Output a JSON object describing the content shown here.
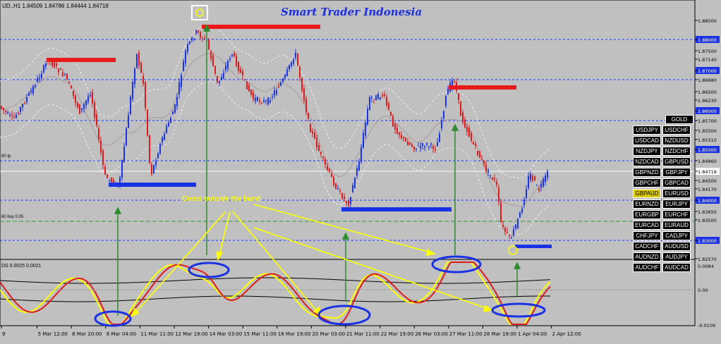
{
  "header": {
    "symbol_line": "UD.,H1  1.84509 1.84786 1.84444 1.84718",
    "title": "Smart Trader Indonesia"
  },
  "levels": {
    "tp_label": "60 tp",
    "buy_label": "60 buy 0.05"
  },
  "indicator": {
    "label": "DS 0.0025 0.0021"
  },
  "annotation": "Cross outside the band",
  "price_scale": [
    "1.88500",
    "1.88000",
    "1.87500",
    "1.87140",
    "1.87000",
    "1.86680",
    "1.86500",
    "1.86230",
    "1.86000",
    "1.85700",
    "1.85500",
    "1.85310",
    "1.85000",
    "1.84860",
    "1.84718",
    "1.84500",
    "1.84170",
    "1.84000",
    "1.83650",
    "1.83500",
    "1.83000",
    "1.82570"
  ],
  "current_price": "1.84718",
  "ind_scale": [
    "0.0084",
    "0.00",
    "-0.0109"
  ],
  "time_axis": [
    "9",
    "5 Mar 12:00",
    "6 Mar 20:00",
    "8 Mar 04:00",
    "11 Mar 11:00",
    "12 Mar 19:00",
    "14 Mar 03:00",
    "15 Mar 11:00",
    "18 Mar 19:00",
    "20 Mar 03:00",
    "21 Mar 11:00",
    "22 Mar 19:00",
    "26 Mar 03:00",
    "27 Mar 11:00",
    "28 Mar 19:00",
    "1 Apr 04:00",
    "2 Apr 12:00"
  ],
  "symbols": [
    [
      "GOLD"
    ],
    [
      "USDJPY",
      "USDCHF"
    ],
    [
      "USDCAD",
      "NZDUSD"
    ],
    [
      "NZDJPY",
      "NZDCHF"
    ],
    [
      "NZDCAD",
      "GBPUSD"
    ],
    [
      "GBPNZD",
      "GBPJPY"
    ],
    [
      "GBPCHF",
      "GBPCAD"
    ],
    [
      "GBPAUD",
      "EURUSD"
    ],
    [
      "EURNZD",
      "EURJPY"
    ],
    [
      "EURGBP",
      "EURCHF"
    ],
    [
      "EURCAD",
      "EURAUD"
    ],
    [
      "CHFJPY",
      "CADJPY"
    ],
    [
      "CADCHF",
      "AUDUSD"
    ],
    [
      "AUDNZD",
      "AUDJPY"
    ],
    [
      "AUDCHF",
      "AUDCAD"
    ]
  ],
  "colors": {
    "bg": "#c0c0c0",
    "bull": "#1a32e6",
    "bear": "#e01a1a",
    "level": "#1a32e6",
    "arrow": "#2e8b2e",
    "annotation": "#ffff00",
    "ellipse": "#1a32e6",
    "sym_hl": "#d8c800"
  }
}
